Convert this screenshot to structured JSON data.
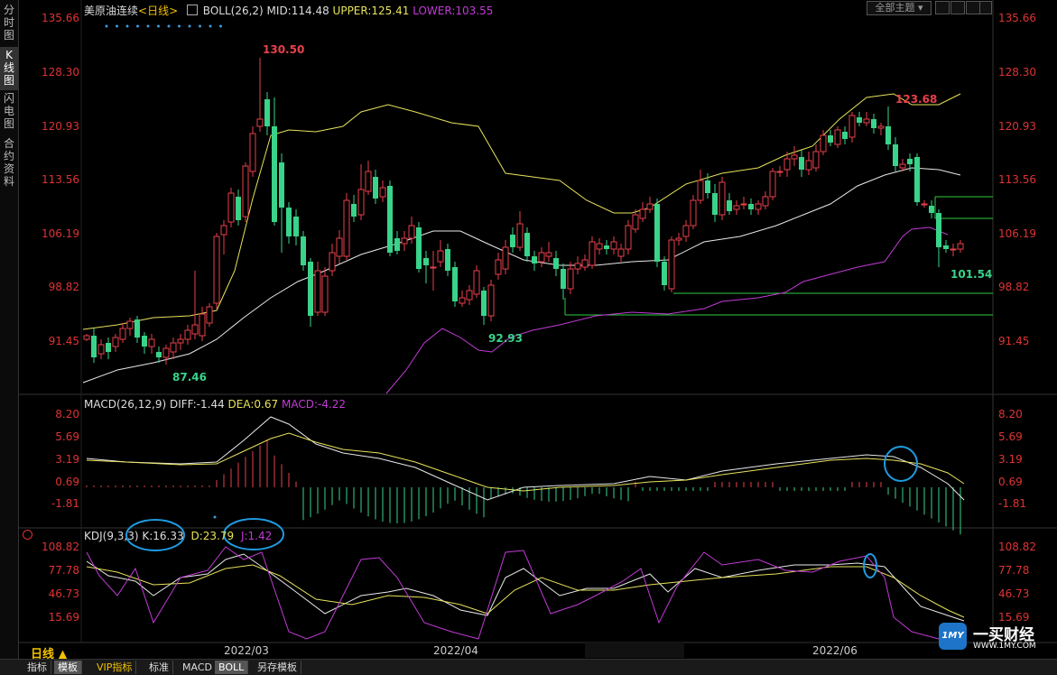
{
  "side_tabs": [
    {
      "label": "分时图",
      "active": false
    },
    {
      "label": "K线图",
      "active": true
    },
    {
      "label": "闪电图",
      "active": false
    },
    {
      "label": "合约资料",
      "active": false
    }
  ],
  "header": {
    "symbol": "美原油连续",
    "period": "<日线>",
    "boll_name": "BOLL(26,2)",
    "mid": "MID:114.48",
    "upper": "UPPER:125.41",
    "lower": "LOWER:103.55",
    "theme_button": "全部主题"
  },
  "price_axis": {
    "ticks": [
      "135.66",
      "128.30",
      "120.93",
      "113.56",
      "106.19",
      "98.82",
      "91.45"
    ]
  },
  "annotations": {
    "high": "130.50",
    "low1": "87.46",
    "low2": "92.93",
    "high2": "123.68",
    "last_low": "101.54"
  },
  "macd": {
    "name": "MACD(26,12,9)",
    "diff": "DIFF:-1.44",
    "dea": "DEA:0.67",
    "macd": "MACD:-4.22",
    "ticks": [
      "8.20",
      "5.69",
      "3.19",
      "0.69",
      "-1.81"
    ]
  },
  "kdj": {
    "name": "KDJ(9,3,3)",
    "k": "K:16.33",
    "d": "D:23.79",
    "j": "J:1.42",
    "ticks": [
      "108.82",
      "77.78",
      "46.73",
      "15.69"
    ]
  },
  "time_axis": {
    "period_label": "日线 ▲",
    "labels": [
      "2022/03",
      "2022/04",
      "2022/06"
    ]
  },
  "bottom_tabs": [
    "指标",
    "模板",
    "VIP指标",
    "标准",
    "MACD",
    "BOLL",
    "另存模板"
  ],
  "watermark": {
    "text": "一买财经",
    "url": "WWW.1MY.COM",
    "logo": "1MY"
  },
  "colors": {
    "up": "#e8414a",
    "down": "#39d38a",
    "upper": "#e6e35a",
    "mid": "#e8e8e8",
    "lower": "#c23bd6",
    "axis": "#d33"
  }
}
